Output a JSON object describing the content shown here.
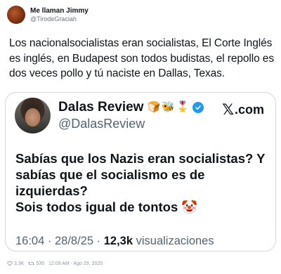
{
  "outer_tweet": {
    "author_name": "Me llaman Jimmy",
    "author_handle": "@TirodeGraciah",
    "text": "Los nacionalsocialistas eran socialistas, El Corte Inglés es inglés, en Budapest son todos budistas, el repollo es dos veces pollo y tú naciste en Dallas, Texas.",
    "likes": "3,3K",
    "retweets": "535",
    "timestamp": "12:09 AM - Ago 29, 2025"
  },
  "quoted_card": {
    "author_name": "Dalas Review",
    "badges": [
      "🍞",
      "🐝",
      "🎖️"
    ],
    "author_handle": "@DalasReview",
    "site": ".com",
    "site_logo": "𝕏",
    "text_lines": [
      "Sabías que los Nazis eran socialistas? Y",
      "sabías que el socialismo es de",
      "izquierdas?",
      "Sois todos igual de tontos 🤡"
    ],
    "time": "16:04",
    "date": "28/8/25",
    "views_count": "12,3k",
    "views_label": "visualizaciones"
  }
}
